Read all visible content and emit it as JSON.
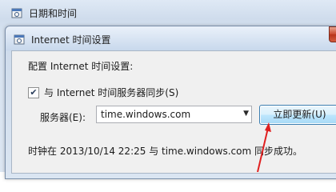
{
  "outer_window": {
    "title": "日期和时间"
  },
  "dialog": {
    "title": "Internet 时间设置",
    "heading": "配置 Internet 时间设置:",
    "sync_checkbox": {
      "checked": true,
      "label": "与 Internet 时间服务器同步(S)"
    },
    "server": {
      "label": "服务器(E):",
      "value": "time.windows.com"
    },
    "update_button": "立即更新(U)",
    "status_text": "时钟在 2013/10/14 22:25 与 time.windows.com 同步成功。"
  },
  "annotation_color": "#e02020"
}
